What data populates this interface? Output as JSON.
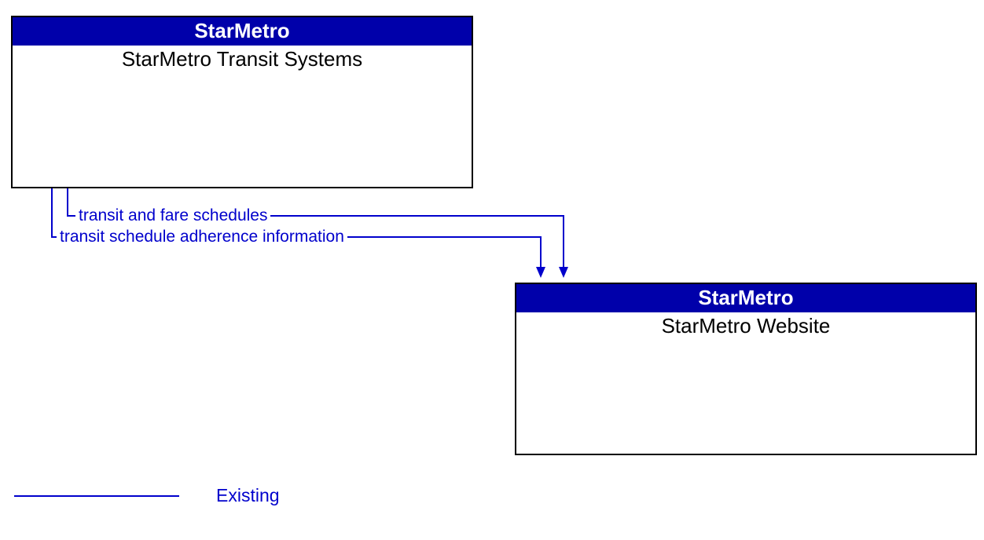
{
  "nodes": {
    "source": {
      "header": "StarMetro",
      "title": "StarMetro Transit Systems"
    },
    "target": {
      "header": "StarMetro",
      "title": "StarMetro Website"
    }
  },
  "flows": {
    "flow1": "transit and fare schedules",
    "flow2": "transit schedule adherence information"
  },
  "legend": {
    "existing": "Existing"
  },
  "colors": {
    "header_bg": "#0000aa",
    "line": "#0000cc"
  }
}
